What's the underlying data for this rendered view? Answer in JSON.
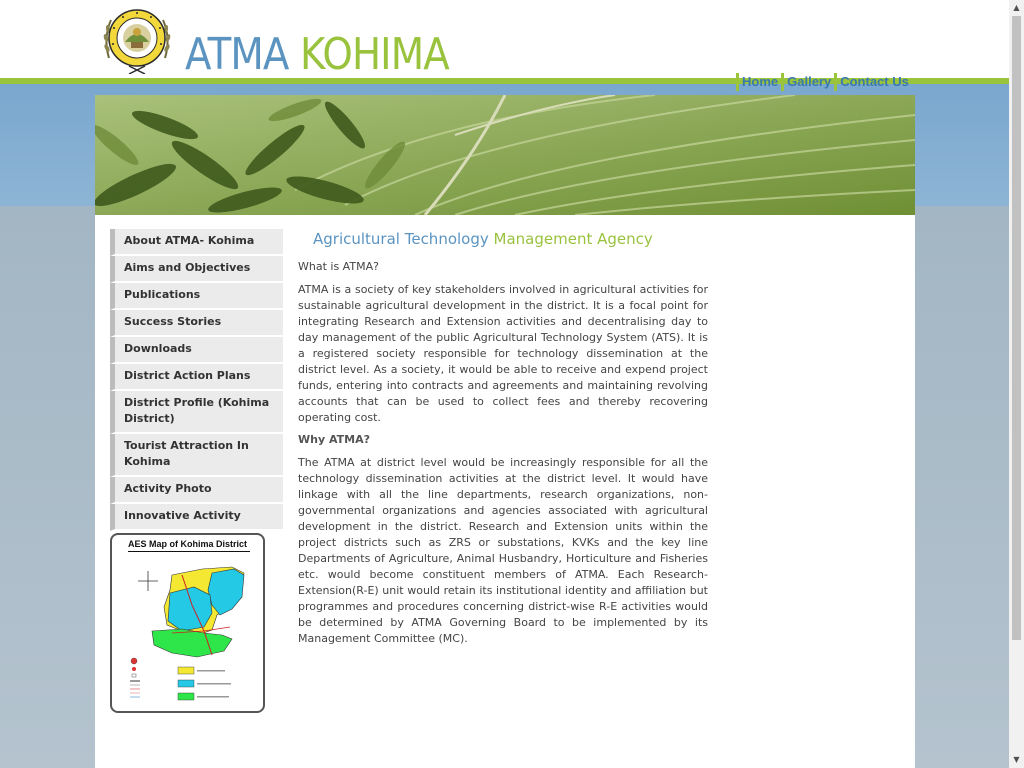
{
  "header": {
    "title_part1": "ATMA",
    "title_part2": "KOHIMA"
  },
  "topnav": [
    {
      "label": "Home"
    },
    {
      "label": "Gallery"
    },
    {
      "label": "Contact Us"
    }
  ],
  "sidebar": {
    "items": [
      {
        "label": "About ATMA- Kohima"
      },
      {
        "label": "Aims and Objectives"
      },
      {
        "label": "Publications"
      },
      {
        "label": "Success Stories"
      },
      {
        "label": "Downloads"
      },
      {
        "label": "District Action Plans"
      },
      {
        "label": "District Profile (Kohima District)"
      },
      {
        "label": "Tourist Attraction In Kohima"
      },
      {
        "label": "Activity Photo"
      },
      {
        "label": "Innovative Activity"
      }
    ],
    "map_title": "AES Map of Kohima District"
  },
  "main": {
    "heading_part1": "Agricultural Technology",
    "heading_part2": "Management Agency",
    "intro_question": "What is ATMA?",
    "para1": "ATMA is a society of key stakeholders involved in agricultural activities for sustainable agricultural development in the district. It is a focal point for integrating Research and Extension activities and decentralising day to day management of the public Agricultural Technology System (ATS). It is a registered society responsible for technology dissemination at the district level. As a society, it would be able to receive and expend project funds, entering into contracts and agreements and maintaining revolving accounts that can be used to collect fees and thereby recovering operating cost.",
    "why_heading": "Why ATMA?",
    "para2": "The ATMA at district level would be increasingly responsible for all the technology dissemination activities at the district level. It would have linkage with all the line departments, research organizations, non-governmental organizations and agencies associated with agricultural development in the district. Research and Extension units within the project districts such as ZRS or substations, KVKs and the key line Departments of Agriculture, Animal Husbandry, Horticulture and Fisheries etc. would become constituent members of ATMA. Each Research-Extension(R-E) unit would retain its institutional identity and affiliation but programmes and procedures concerning district-wise R-E activities would be determined by ATMA Governing Board to be implemented by its Management Committee (MC)."
  },
  "colors": {
    "brand_blue": "#5b94c0",
    "brand_green": "#99c23d",
    "nav_blue": "#3a78b0"
  },
  "icons": {
    "scroll_up": "▲",
    "scroll_down": "▼"
  }
}
